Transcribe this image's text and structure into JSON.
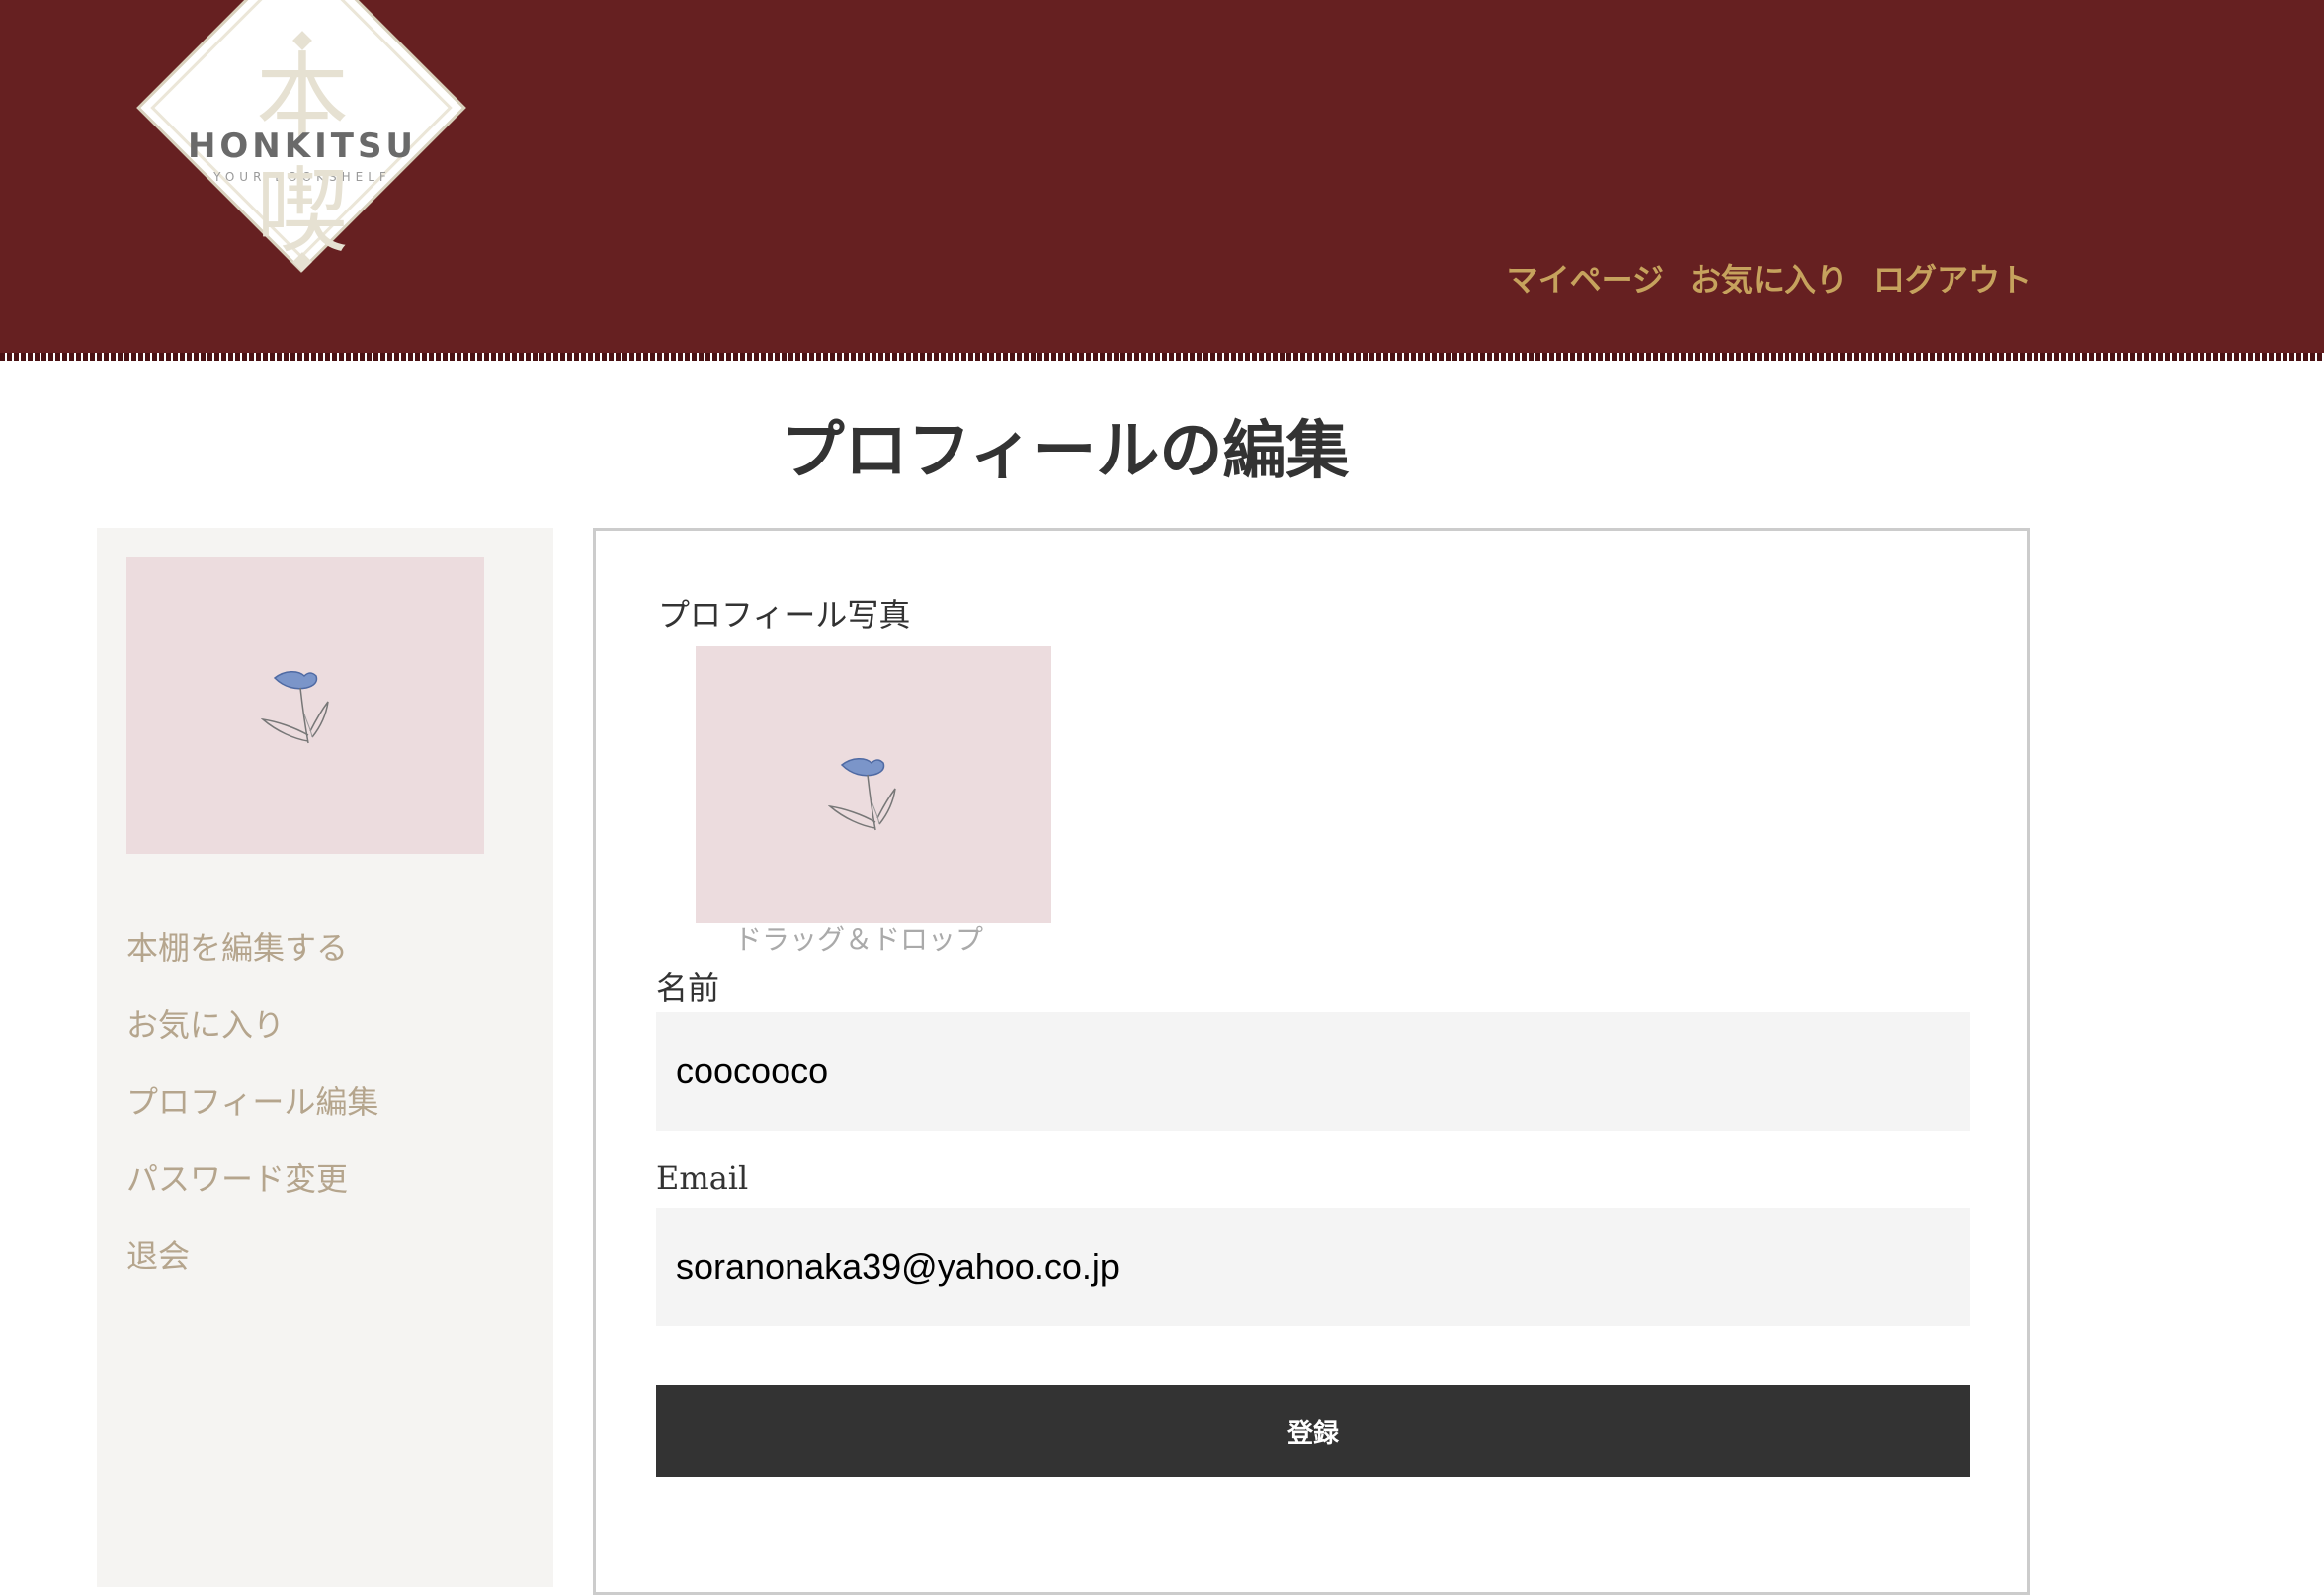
{
  "brand": {
    "name": "HONKITSU",
    "tagline": "YOUR BOOKSHELF",
    "kanji_top": "本",
    "kanji_bottom": "喫",
    "header_color": "#662021",
    "accent_color": "#c6a25d"
  },
  "nav": {
    "mypage": "マイページ",
    "favorites": "お気に入り",
    "logout": "ログアウト"
  },
  "page": {
    "title": "プロフィールの編集"
  },
  "sidebar": {
    "avatar_icon": "tulip-icon",
    "items": [
      {
        "label": "本棚を編集する"
      },
      {
        "label": "お気に入り"
      },
      {
        "label": "プロフィール編集"
      },
      {
        "label": "パスワード変更"
      },
      {
        "label": "退会"
      }
    ]
  },
  "form": {
    "photo_label": "プロフィール写真",
    "photo_hint": "ドラッグ＆ドロップ",
    "name_label": "名前",
    "name_value": "coocooco",
    "email_label": "Email",
    "email_value": "soranonaka39@yahoo.co.jp",
    "submit_label": "登録"
  }
}
